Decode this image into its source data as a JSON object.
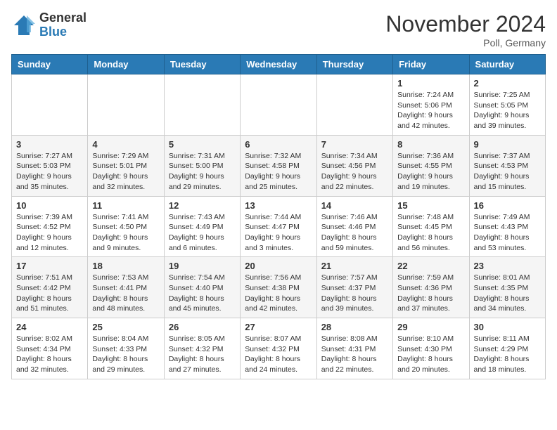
{
  "header": {
    "logo_general": "General",
    "logo_blue": "Blue",
    "month_title": "November 2024",
    "location": "Poll, Germany"
  },
  "weekdays": [
    "Sunday",
    "Monday",
    "Tuesday",
    "Wednesday",
    "Thursday",
    "Friday",
    "Saturday"
  ],
  "weeks": [
    [
      {
        "day": "",
        "info": ""
      },
      {
        "day": "",
        "info": ""
      },
      {
        "day": "",
        "info": ""
      },
      {
        "day": "",
        "info": ""
      },
      {
        "day": "",
        "info": ""
      },
      {
        "day": "1",
        "info": "Sunrise: 7:24 AM\nSunset: 5:06 PM\nDaylight: 9 hours\nand 42 minutes."
      },
      {
        "day": "2",
        "info": "Sunrise: 7:25 AM\nSunset: 5:05 PM\nDaylight: 9 hours\nand 39 minutes."
      }
    ],
    [
      {
        "day": "3",
        "info": "Sunrise: 7:27 AM\nSunset: 5:03 PM\nDaylight: 9 hours\nand 35 minutes."
      },
      {
        "day": "4",
        "info": "Sunrise: 7:29 AM\nSunset: 5:01 PM\nDaylight: 9 hours\nand 32 minutes."
      },
      {
        "day": "5",
        "info": "Sunrise: 7:31 AM\nSunset: 5:00 PM\nDaylight: 9 hours\nand 29 minutes."
      },
      {
        "day": "6",
        "info": "Sunrise: 7:32 AM\nSunset: 4:58 PM\nDaylight: 9 hours\nand 25 minutes."
      },
      {
        "day": "7",
        "info": "Sunrise: 7:34 AM\nSunset: 4:56 PM\nDaylight: 9 hours\nand 22 minutes."
      },
      {
        "day": "8",
        "info": "Sunrise: 7:36 AM\nSunset: 4:55 PM\nDaylight: 9 hours\nand 19 minutes."
      },
      {
        "day": "9",
        "info": "Sunrise: 7:37 AM\nSunset: 4:53 PM\nDaylight: 9 hours\nand 15 minutes."
      }
    ],
    [
      {
        "day": "10",
        "info": "Sunrise: 7:39 AM\nSunset: 4:52 PM\nDaylight: 9 hours\nand 12 minutes."
      },
      {
        "day": "11",
        "info": "Sunrise: 7:41 AM\nSunset: 4:50 PM\nDaylight: 9 hours\nand 9 minutes."
      },
      {
        "day": "12",
        "info": "Sunrise: 7:43 AM\nSunset: 4:49 PM\nDaylight: 9 hours\nand 6 minutes."
      },
      {
        "day": "13",
        "info": "Sunrise: 7:44 AM\nSunset: 4:47 PM\nDaylight: 9 hours\nand 3 minutes."
      },
      {
        "day": "14",
        "info": "Sunrise: 7:46 AM\nSunset: 4:46 PM\nDaylight: 8 hours\nand 59 minutes."
      },
      {
        "day": "15",
        "info": "Sunrise: 7:48 AM\nSunset: 4:45 PM\nDaylight: 8 hours\nand 56 minutes."
      },
      {
        "day": "16",
        "info": "Sunrise: 7:49 AM\nSunset: 4:43 PM\nDaylight: 8 hours\nand 53 minutes."
      }
    ],
    [
      {
        "day": "17",
        "info": "Sunrise: 7:51 AM\nSunset: 4:42 PM\nDaylight: 8 hours\nand 51 minutes."
      },
      {
        "day": "18",
        "info": "Sunrise: 7:53 AM\nSunset: 4:41 PM\nDaylight: 8 hours\nand 48 minutes."
      },
      {
        "day": "19",
        "info": "Sunrise: 7:54 AM\nSunset: 4:40 PM\nDaylight: 8 hours\nand 45 minutes."
      },
      {
        "day": "20",
        "info": "Sunrise: 7:56 AM\nSunset: 4:38 PM\nDaylight: 8 hours\nand 42 minutes."
      },
      {
        "day": "21",
        "info": "Sunrise: 7:57 AM\nSunset: 4:37 PM\nDaylight: 8 hours\nand 39 minutes."
      },
      {
        "day": "22",
        "info": "Sunrise: 7:59 AM\nSunset: 4:36 PM\nDaylight: 8 hours\nand 37 minutes."
      },
      {
        "day": "23",
        "info": "Sunrise: 8:01 AM\nSunset: 4:35 PM\nDaylight: 8 hours\nand 34 minutes."
      }
    ],
    [
      {
        "day": "24",
        "info": "Sunrise: 8:02 AM\nSunset: 4:34 PM\nDaylight: 8 hours\nand 32 minutes."
      },
      {
        "day": "25",
        "info": "Sunrise: 8:04 AM\nSunset: 4:33 PM\nDaylight: 8 hours\nand 29 minutes."
      },
      {
        "day": "26",
        "info": "Sunrise: 8:05 AM\nSunset: 4:32 PM\nDaylight: 8 hours\nand 27 minutes."
      },
      {
        "day": "27",
        "info": "Sunrise: 8:07 AM\nSunset: 4:32 PM\nDaylight: 8 hours\nand 24 minutes."
      },
      {
        "day": "28",
        "info": "Sunrise: 8:08 AM\nSunset: 4:31 PM\nDaylight: 8 hours\nand 22 minutes."
      },
      {
        "day": "29",
        "info": "Sunrise: 8:10 AM\nSunset: 4:30 PM\nDaylight: 8 hours\nand 20 minutes."
      },
      {
        "day": "30",
        "info": "Sunrise: 8:11 AM\nSunset: 4:29 PM\nDaylight: 8 hours\nand 18 minutes."
      }
    ]
  ]
}
